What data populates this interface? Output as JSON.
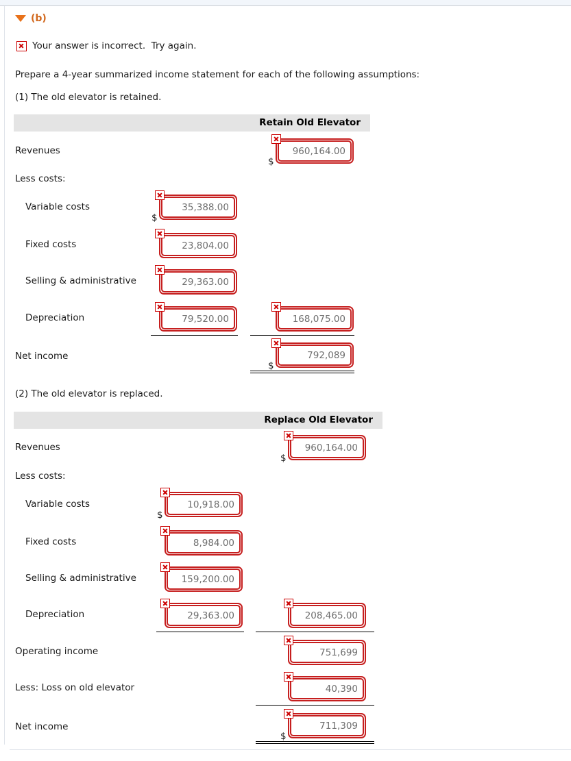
{
  "part": {
    "marker_icon": "triangle-down-icon",
    "label": "(b)"
  },
  "feedback": {
    "icon": "incorrect-x-icon",
    "text": "Your answer is incorrect.  Try again."
  },
  "instructions": "Prepare a 4-year summarized income statement for each of the following assumptions:",
  "statements": [
    {
      "intro": "(1) The old elevator is retained.",
      "header": "Retain Old Elevator",
      "rows": [
        {
          "label": "Revenues",
          "col": 2,
          "dollar": true,
          "value": "960,164.00"
        },
        {
          "label": "Less costs:",
          "col": 0,
          "dollar": false,
          "value": ""
        },
        {
          "label": "Variable costs",
          "col": 1,
          "dollar": true,
          "value": "35,388.00"
        },
        {
          "label": "Fixed costs",
          "col": 1,
          "dollar": false,
          "value": "23,804.00"
        },
        {
          "label": "Selling & administrative",
          "col": 1,
          "dollar": false,
          "value": "29,363.00"
        },
        {
          "label": "Depreciation",
          "col": 1,
          "dollar": false,
          "value": "79,520.00",
          "value2": "168,075.00"
        },
        {
          "label": "Net income",
          "col": 2,
          "dollar": true,
          "value": "792,089"
        }
      ]
    },
    {
      "intro": "(2) The old elevator is replaced.",
      "header": "Replace Old Elevator",
      "rows": [
        {
          "label": "Revenues",
          "col": 2,
          "dollar": true,
          "value": "960,164.00"
        },
        {
          "label": "Less costs:",
          "col": 0,
          "dollar": false,
          "value": ""
        },
        {
          "label": "Variable costs",
          "col": 1,
          "dollar": true,
          "value": "10,918.00"
        },
        {
          "label": "Fixed costs",
          "col": 1,
          "dollar": false,
          "value": "8,984.00"
        },
        {
          "label": "Selling & administrative",
          "col": 1,
          "dollar": false,
          "value": "159,200.00"
        },
        {
          "label": "Depreciation",
          "col": 1,
          "dollar": false,
          "value": "29,363.00",
          "value2": "208,465.00"
        },
        {
          "label": "Operating income",
          "col": 2,
          "dollar": false,
          "value": "751,699"
        },
        {
          "label": "Less: Loss on old elevator",
          "col": 2,
          "dollar": false,
          "value": "40,390"
        },
        {
          "label": "Net income",
          "col": 2,
          "dollar": true,
          "value": "711,309"
        }
      ]
    }
  ],
  "colors": {
    "error_border": "#c61f1f",
    "error_badge": "#cc0000",
    "part_label": "#d2691e",
    "marker": "#e8711a",
    "table_header_bg": "#e4e4e4",
    "value_text": "#6e6e6e"
  }
}
